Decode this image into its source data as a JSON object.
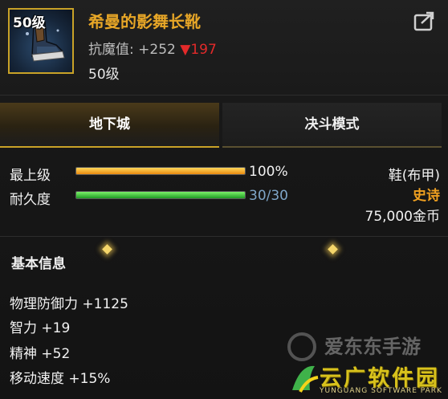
{
  "item": {
    "level_badge": "50级",
    "name": "希曼的影舞长靴",
    "resist_label": "抗魔值:",
    "resist_value": "+252",
    "resist_down_arrow": "▼",
    "resist_down_value": "197",
    "level_text": "50级",
    "share_icon": "share-icon",
    "name_color": "#e7a627"
  },
  "tabs": [
    {
      "label": "地下城",
      "active": true
    },
    {
      "label": "决斗模式",
      "active": false
    }
  ],
  "stats": {
    "top_level": {
      "label": "最上级",
      "value": "100%",
      "fill": 1.0,
      "color": "#f0a030"
    },
    "durability": {
      "label": "耐久度",
      "value": "30/30",
      "fill": 1.0,
      "color": "#3cc43c"
    }
  },
  "right_info": {
    "type": "鞋(布甲)",
    "rarity": "史诗",
    "rarity_color": "#f0a020",
    "price": "75,000金币"
  },
  "basic_info": {
    "title": "基本信息",
    "attributes": [
      "物理防御力 +1125",
      "智力 +19",
      "精神 +52",
      "移动速度 +15%"
    ]
  },
  "watermarks": {
    "w1": "爱东东手游",
    "w2": "云广软件园",
    "w2_sub": "YUNGUANG SOFTWARE PARK"
  }
}
